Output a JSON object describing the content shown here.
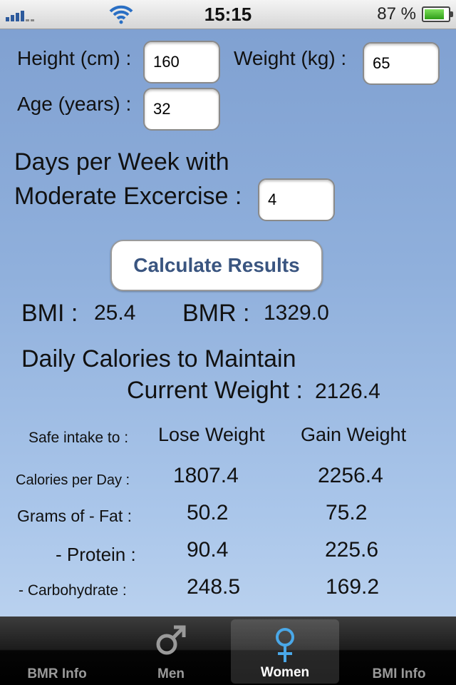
{
  "status": {
    "time": "15:15",
    "battery_pct": "87 %"
  },
  "inputs": {
    "height_label": "Height (cm) :",
    "height_value": "160",
    "weight_label": "Weight (kg) :",
    "weight_value": "65",
    "age_label": "Age (years) :",
    "age_value": "32",
    "days_label_line1": "Days per Week with",
    "days_label_line2": "Moderate Excercise :",
    "days_value": "4"
  },
  "calculate_label": "Calculate Results",
  "results": {
    "bmi_label": "BMI :",
    "bmi_value": "25.4",
    "bmr_label": "BMR :",
    "bmr_value": "1329.0",
    "daily_line1": "Daily Calories to Maintain",
    "daily_line2": "Current Weight :",
    "daily_value": "2126.4"
  },
  "table": {
    "header_label": "Safe intake to :",
    "col_lose": "Lose Weight",
    "col_gain": "Gain Weight",
    "rows": [
      {
        "label": "Calories per Day :",
        "lose": "1807.4",
        "gain": "2256.4"
      },
      {
        "label": "Grams of - Fat :",
        "lose": "50.2",
        "gain": "75.2"
      },
      {
        "label": "- Protein :",
        "lose": "90.4",
        "gain": "225.6"
      },
      {
        "label": "- Carbohydrate :",
        "lose": "248.5",
        "gain": "169.2"
      }
    ]
  },
  "tabs": [
    {
      "label": "BMR Info",
      "icon": ""
    },
    {
      "label": "Men",
      "icon": "male-symbol"
    },
    {
      "label": "Women",
      "icon": "female-symbol",
      "active": true
    },
    {
      "label": "BMI Info",
      "icon": ""
    }
  ],
  "colors": {
    "accent_blue": "#3a5580",
    "female_icon": "#4aa8e8"
  }
}
